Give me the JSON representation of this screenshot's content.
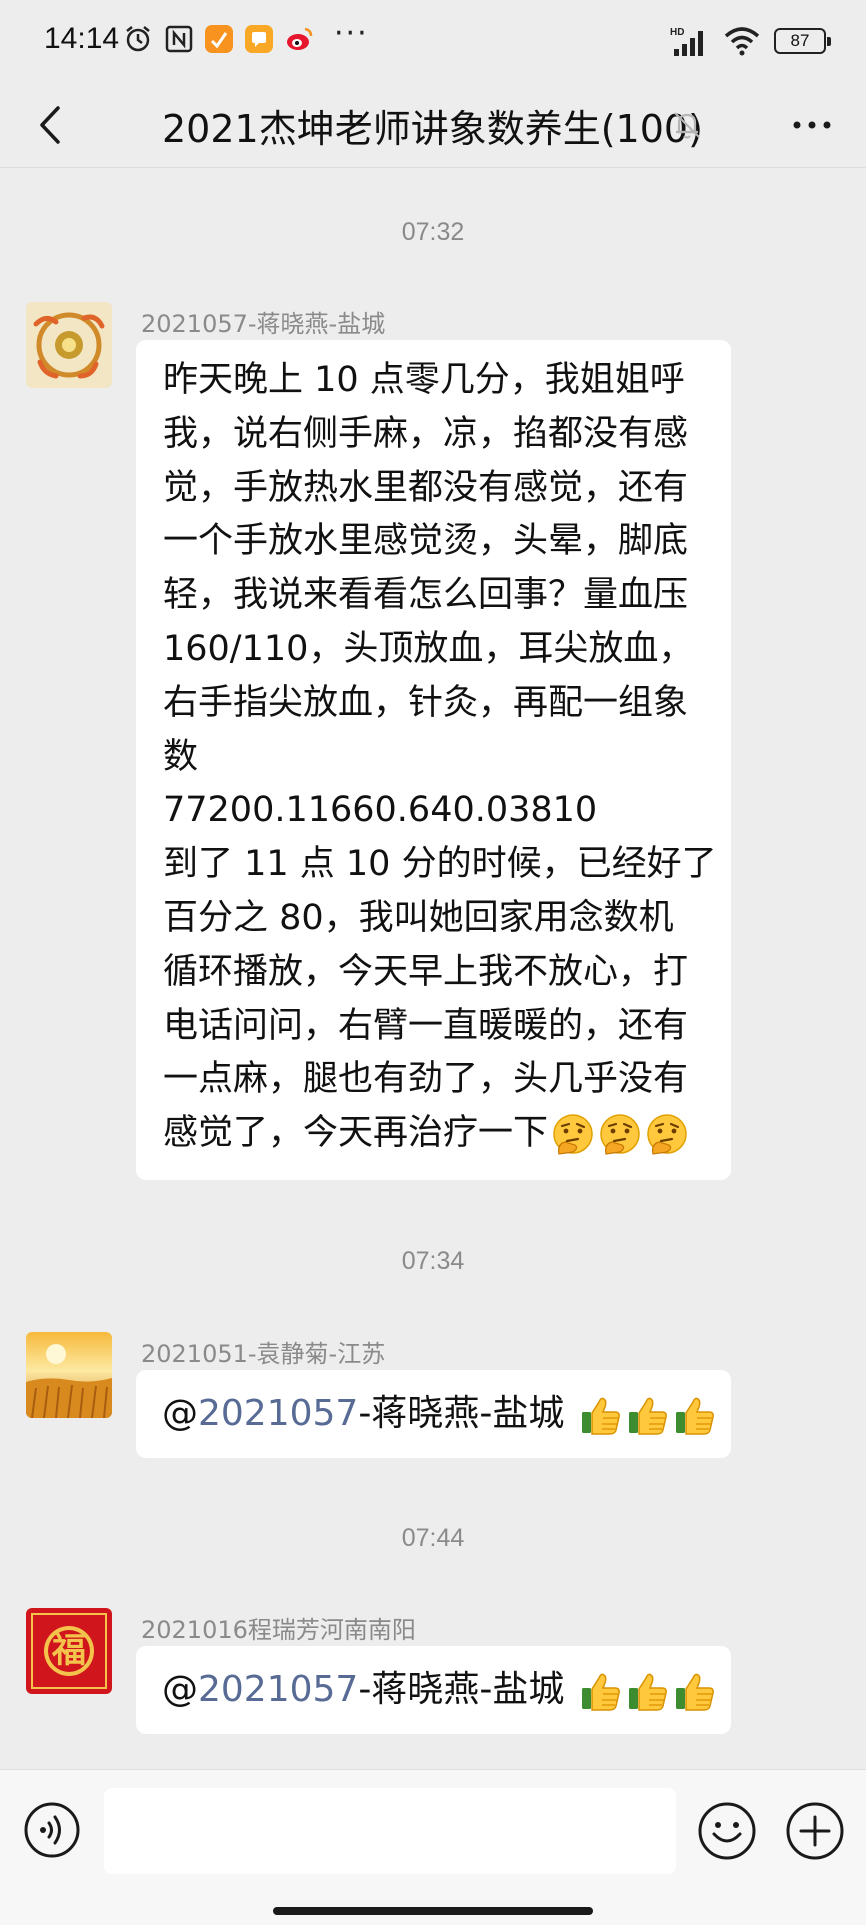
{
  "status_bar": {
    "time": "14:14",
    "more_indicator": "···",
    "battery": "87",
    "icons": [
      "alarm-icon",
      "nfc-icon",
      "app-notification-icon",
      "message-notification-icon",
      "weibo-icon",
      "hd-signal-icon",
      "wifi-icon",
      "battery-icon"
    ]
  },
  "header": {
    "title": "2021杰坤老师讲象数养生(100)",
    "icons": [
      "back-icon",
      "mute-bell-icon",
      "more-icon"
    ]
  },
  "messages": [
    {
      "time": "07:32",
      "sender": "2021057-蒋晓燕-盐城",
      "lines": [
        "昨天晚上 10 点零几分，我姐姐呼",
        "我，说右侧手麻，凉，掐都没有感",
        "觉，手放热水里都没有感觉，还有",
        "一个手放水里感觉烫，头晕，脚底",
        "轻，我说来看看怎么回事？量血压",
        "160/110，头顶放血，耳尖放血，",
        "右手指尖放血，针灸，再配一组象",
        "数",
        "77200.11660.640.03810",
        "到了 11 点 10 分的时候，已经好了",
        "百分之 80，我叫她回家用念数机",
        "循环播放，今天早上我不放心，打",
        "电话问问，右臂一直暖暖的，还有",
        "一点麻，腿也有劲了，头几乎没有",
        "感觉了，今天再治疗一下"
      ],
      "emojis": [
        "thinking-emoji",
        "thinking-emoji",
        "thinking-emoji"
      ]
    },
    {
      "time": "07:34",
      "sender": "2021051-袁静菊-江苏",
      "mention_at": "@",
      "mention_id": "2021057",
      "mention_rest": "-蒋晓燕-盐城",
      "emojis": [
        "thumbs-up-emoji",
        "thumbs-up-emoji",
        "thumbs-up-emoji"
      ]
    },
    {
      "time": "07:44",
      "sender": "2021016程瑞芳河南南阳",
      "avatar_text": "福",
      "mention_at": "@",
      "mention_id": "2021057",
      "mention_rest": "-蒋晓燕-盐城",
      "emojis": [
        "thumbs-up-emoji",
        "thumbs-up-emoji",
        "thumbs-up-emoji"
      ]
    }
  ],
  "input_bar": {
    "placeholder": "",
    "icons": [
      "voice-icon",
      "emoji-icon",
      "plus-icon"
    ]
  },
  "colors": {
    "background": "#ededed",
    "bubble": "#ffffff",
    "mention": "#576b95",
    "timestamp": "#8a8a8a"
  }
}
